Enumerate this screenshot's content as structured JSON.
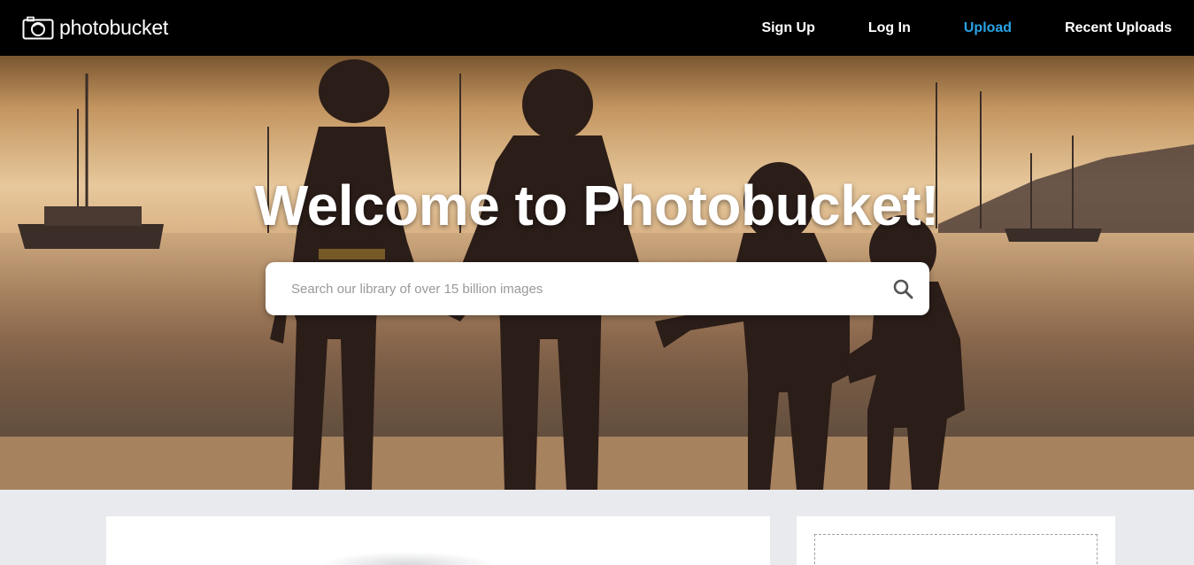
{
  "header": {
    "logo_text": "photobucket",
    "nav": [
      {
        "label": "Sign Up"
      },
      {
        "label": "Log In"
      },
      {
        "label": "Upload",
        "active": true
      },
      {
        "label": "Recent Uploads"
      }
    ]
  },
  "hero": {
    "title": "Welcome to Photobucket!",
    "search_placeholder": "Search our library of over 15 billion images",
    "search_icon": "search-icon"
  },
  "colors": {
    "header_bg": "#000000",
    "accent": "#2aa3e6",
    "page_bg": "#e8eaed"
  }
}
